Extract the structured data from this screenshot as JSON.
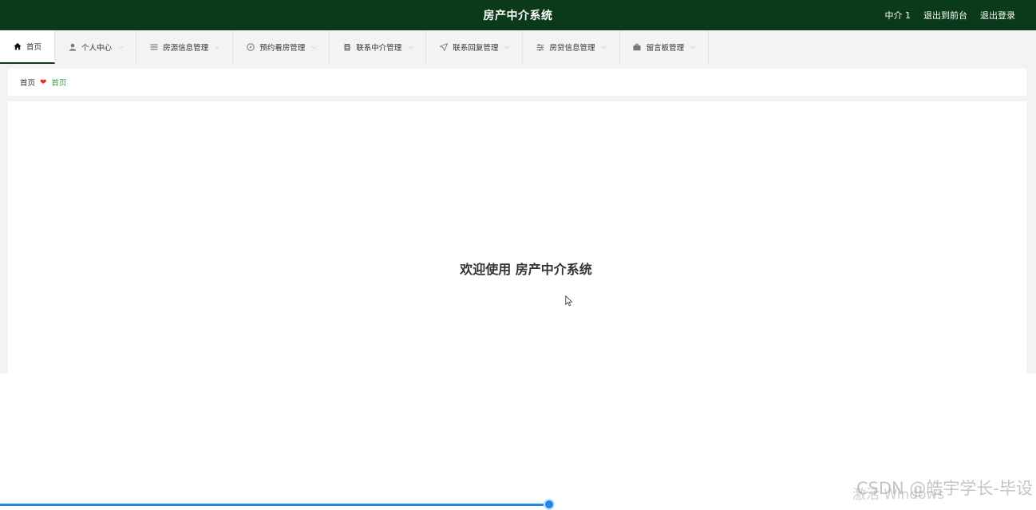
{
  "header": {
    "title": "房产中介系统",
    "user": "中介 1",
    "to_front": "退出到前台",
    "logout": "退出登录"
  },
  "nav": {
    "items": [
      {
        "label": "首页",
        "icon": "home-icon",
        "active": true
      },
      {
        "label": "个人中心",
        "icon": "user-icon"
      },
      {
        "label": "房源信息管理",
        "icon": "list-icon"
      },
      {
        "label": "预约看房管理",
        "icon": "compass-icon"
      },
      {
        "label": "联系中介管理",
        "icon": "clipboard-icon"
      },
      {
        "label": "联系回复管理",
        "icon": "send-icon"
      },
      {
        "label": "房贷信息管理",
        "icon": "sliders-icon"
      },
      {
        "label": "留言板管理",
        "icon": "briefcase-icon"
      }
    ]
  },
  "breadcrumb": {
    "home": "首页",
    "current": "首页"
  },
  "main": {
    "welcome": "欢迎使用 房产中介系统"
  },
  "watermark": {
    "text": "CSDN @皓宇学长-毕设",
    "activate": "激活 Windows"
  },
  "colors": {
    "header_bg": "#0b3a1a",
    "breadcrumb_current": "#3b9b4b",
    "progress": "#1e88e5"
  }
}
